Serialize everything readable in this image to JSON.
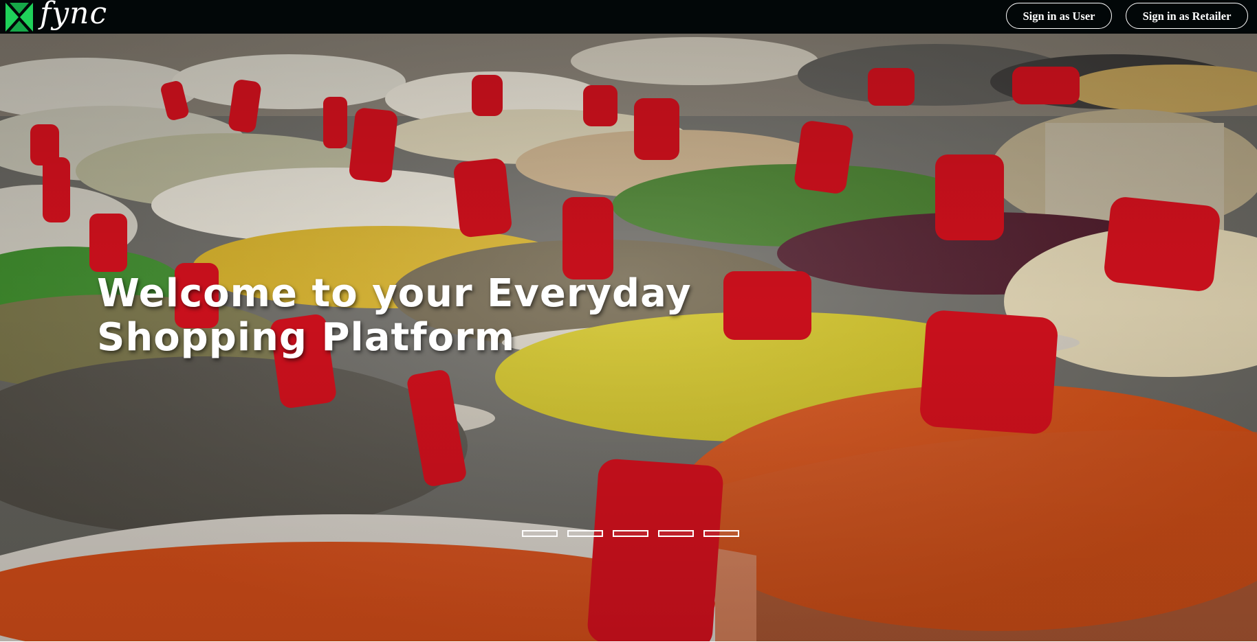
{
  "brand": {
    "name": "fync",
    "logo_icon": "bowtie-logo-icon",
    "logo_color": "#1fd25a"
  },
  "nav": {
    "sign_in_user": "Sign in as User",
    "sign_in_retailer": "Sign in as Retailer"
  },
  "hero": {
    "title_line1": "Welcome to your Everyday",
    "title_line2": "Shopping Platform",
    "slide_count": 5,
    "active_slide": 1
  },
  "colors": {
    "navbar_bg": "#020708",
    "text": "#ffffff",
    "tag_red": "#c8101c"
  }
}
